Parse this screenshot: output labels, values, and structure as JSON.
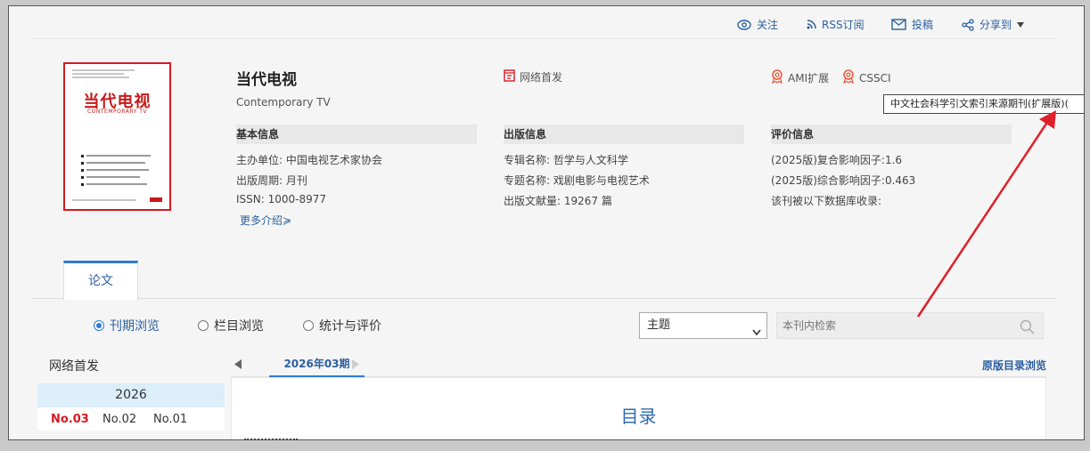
{
  "topbar": {
    "follow": "关注",
    "rss": "RSS订阅",
    "submit": "投稿",
    "share": "分享到"
  },
  "cover": {
    "title_cn": "当代电视",
    "title_en": "CONTEMPORARY TV"
  },
  "journal": {
    "title": "当代电视",
    "subtitle": "Contemporary TV",
    "online_first": "网络首发",
    "badges": [
      "AMI扩展",
      "CSSCI"
    ],
    "tooltip": "中文社会科学引文索引来源期刊(扩展版)("
  },
  "basic_info": {
    "heading": "基本信息",
    "sponsor_label": "主办单位:",
    "sponsor": "中国电视艺术家协会",
    "cycle_label": "出版周期:",
    "cycle": "月刊",
    "issn_label": "ISSN:",
    "issn": "1000-8977",
    "more": "更多介绍"
  },
  "publish_info": {
    "heading": "出版信息",
    "series_label": "专辑名称:",
    "series": "哲学与人文科学",
    "topic_label": "专题名称:",
    "topic": "戏剧电影与电视艺术",
    "count_label": "出版文献量:",
    "count": "19267 篇"
  },
  "eval_info": {
    "heading": "评价信息",
    "composite": "(2025版)复合影响因子:1.6",
    "comprehensive": "(2025版)综合影响因子:0.463",
    "db": "该刊被以下数据库收录:"
  },
  "tabs": {
    "papers": "论文"
  },
  "browse": {
    "by_issue": "刊期浏览",
    "by_column": "栏目浏览",
    "stats": "统计与评价",
    "selected": "刊期浏览"
  },
  "search": {
    "field": "主题",
    "placeholder": "本刊内检索"
  },
  "sidebar": {
    "title": "网络首发",
    "year": "2026",
    "issues": [
      "No.03",
      "No.02",
      "No.01"
    ],
    "current_issue": "No.03"
  },
  "issue_nav": {
    "current": "2026年03期",
    "original_toc": "原版目录浏览"
  },
  "toc": {
    "title": "目录"
  },
  "colors": {
    "link_blue": "#2b5f9e",
    "accent_blue": "#2b7cd3",
    "brand_red": "#d71920",
    "annotation_arrow": "#e0202a"
  }
}
